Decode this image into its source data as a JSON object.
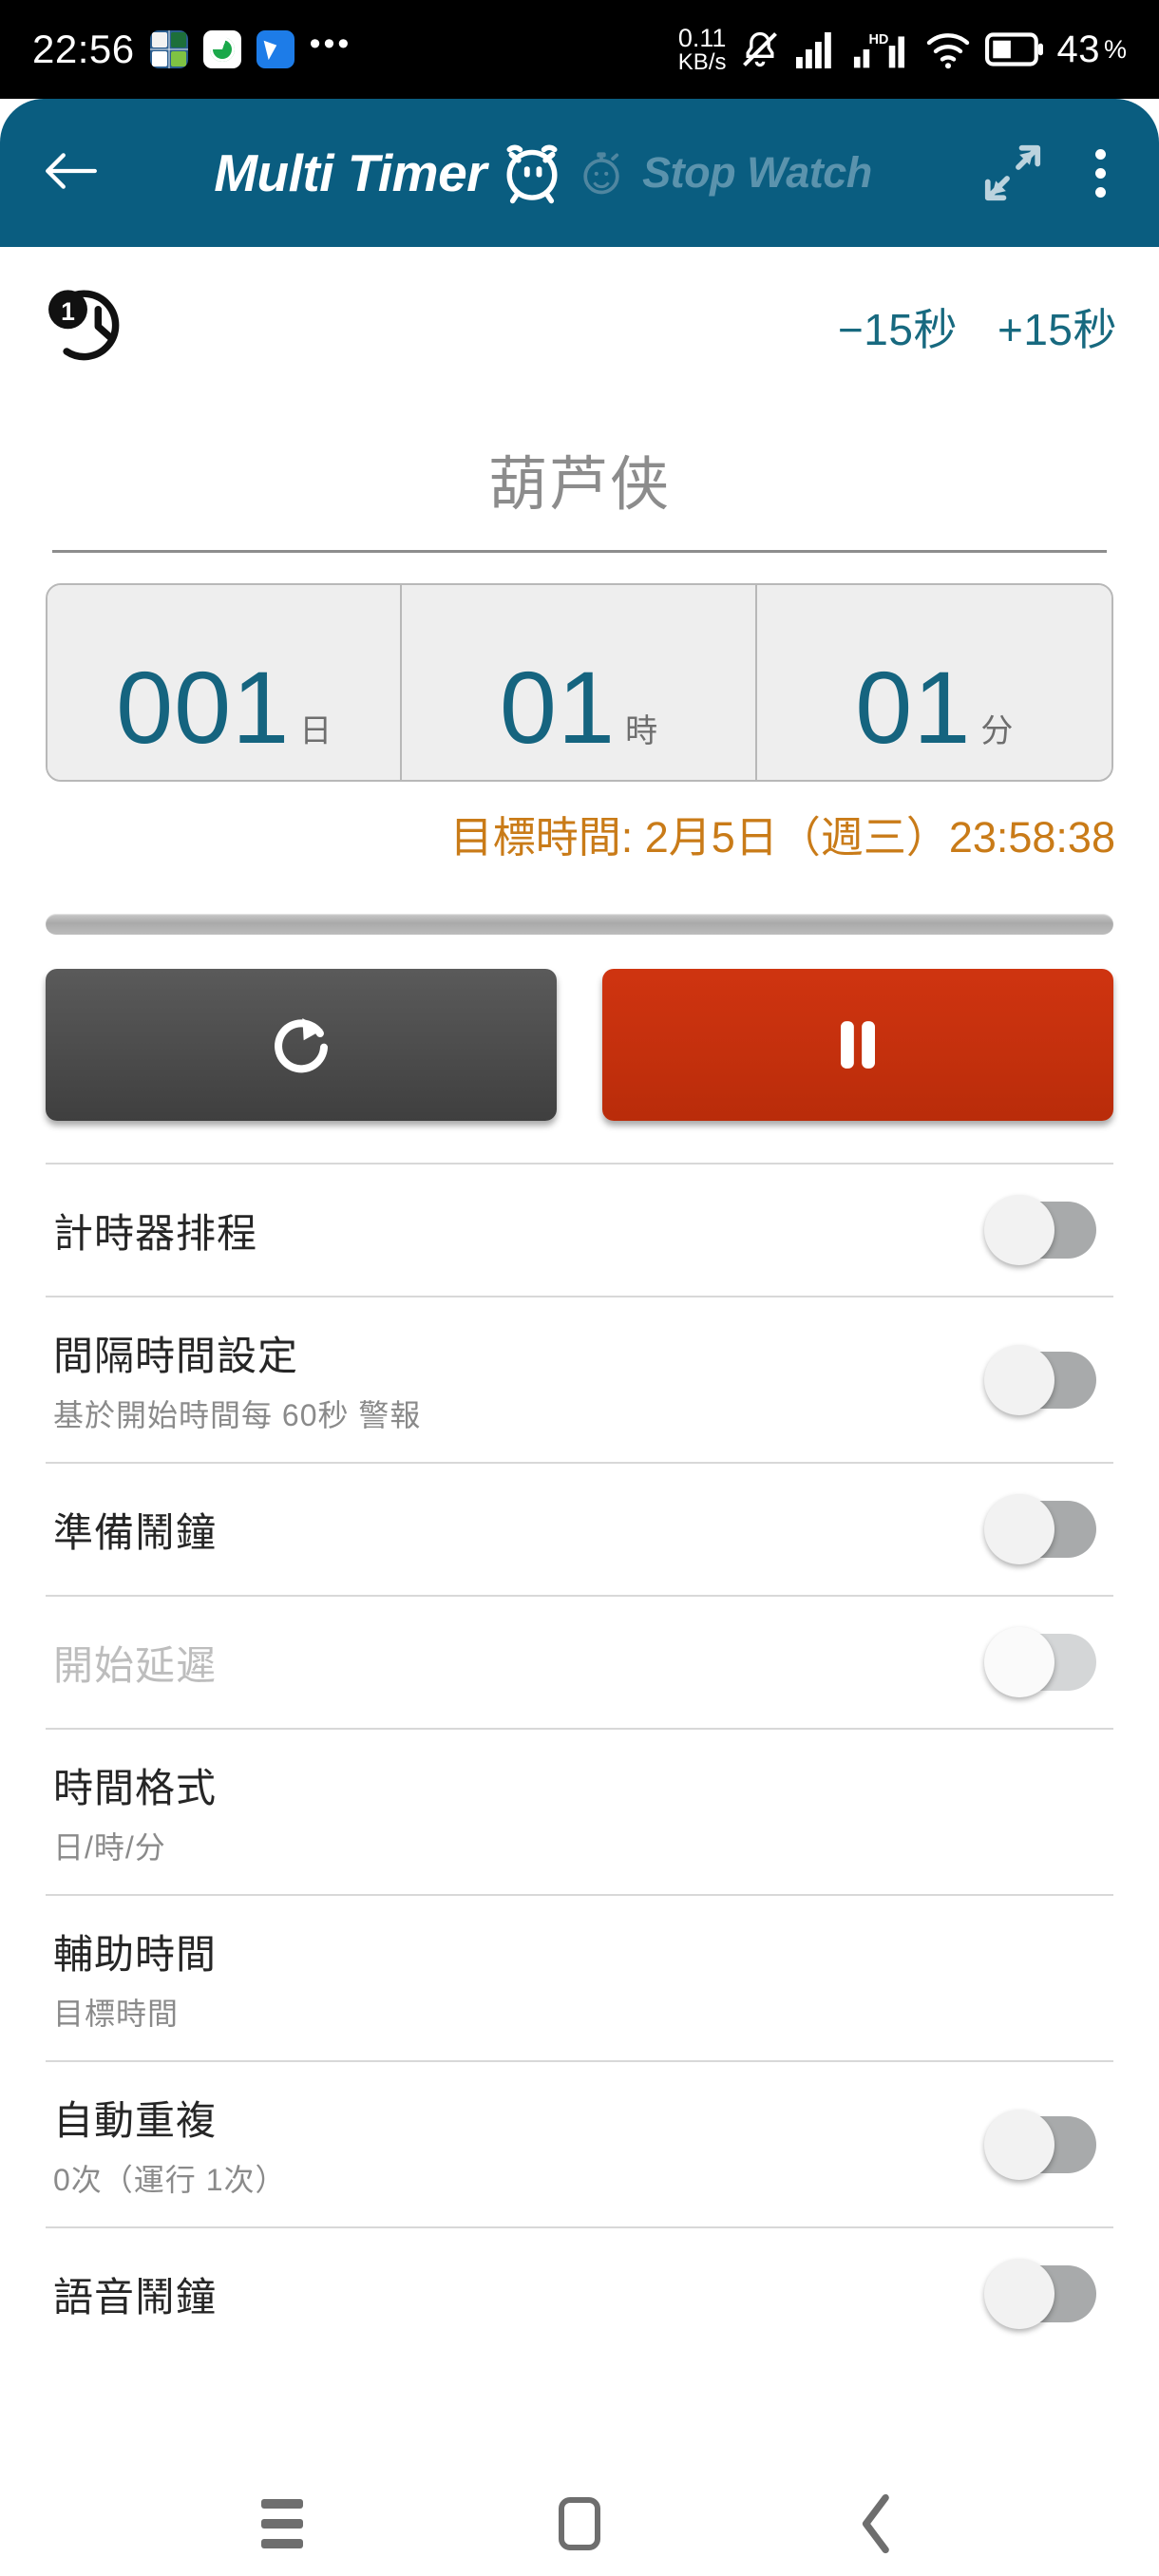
{
  "status_bar": {
    "time": "22:56",
    "overflow_dots": "•••",
    "network_speed_value": "0.11",
    "network_speed_unit": "KB/s",
    "volume_state": "mute-icon",
    "signal_1": "signal-bars-icon",
    "hd_label": "HD",
    "signal_2": "signal-bars-icon",
    "wifi": "wifi-icon",
    "battery_percent": "43",
    "battery_suffix": "%",
    "app_icons": [
      "app-grid-icon",
      "green-circle-icon",
      "blue-bird-icon"
    ],
    "background_color": "#000000"
  },
  "app_bar": {
    "back_label": "back-arrow-icon",
    "title": "Multi Timer",
    "alarm_icon": "alarm-clock-icon",
    "stopwatch_icon": "stopwatch-icon",
    "stopwatch_label": "Stop Watch",
    "expand_icon": "expand-diagonal-icon",
    "menu_icon": "kebab-menu-icon",
    "background_color": "#0a5d80",
    "title_color": "#ffffff",
    "inactive_color": "#5b93ad"
  },
  "timer": {
    "index_icon": "clock-badge-1-icon",
    "decrement_label": "−15秒",
    "increment_label": "+15秒",
    "accent_color": "#17697f",
    "name": "葫芦侠",
    "fields": [
      {
        "value": "001",
        "unit": "日"
      },
      {
        "value": "01",
        "unit": "時"
      },
      {
        "value": "01",
        "unit": "分"
      }
    ],
    "target_time": "目標時間: 2月5日（週三）23:58:38",
    "target_time_color": "#c97b18",
    "digit_color": "#15647f",
    "progress_percent": 0,
    "reset_icon": "reset-circular-arrow-icon",
    "pause_icon": "pause-icon",
    "reset_button_color": "#4c4c4c",
    "pause_button_color": "#c4300d"
  },
  "settings": [
    {
      "title": "計時器排程",
      "sub": "",
      "control": "toggle",
      "state": "off",
      "disabled": false
    },
    {
      "title": "間隔時間設定",
      "sub": "基於開始時間每 60秒 警報",
      "control": "toggle",
      "state": "off",
      "disabled": false
    },
    {
      "title": "準備鬧鐘",
      "sub": "",
      "control": "toggle",
      "state": "off",
      "disabled": false
    },
    {
      "title": "開始延遲",
      "sub": "",
      "control": "toggle",
      "state": "off",
      "disabled": true
    },
    {
      "title": "時間格式",
      "sub": "日/時/分",
      "control": "none",
      "disabled": false
    },
    {
      "title": "輔助時間",
      "sub": "目標時間",
      "control": "none",
      "disabled": false
    },
    {
      "title": "自動重複",
      "sub": "0次（運行 1次）",
      "control": "toggle",
      "state": "off",
      "disabled": false
    },
    {
      "title": "語音鬧鐘",
      "sub": "",
      "control": "toggle",
      "state": "off",
      "disabled": false
    }
  ],
  "nav_bar": {
    "recents_icon": "hamburger-recents-icon",
    "home_icon": "home-square-icon",
    "back_icon": "back-chevron-icon"
  }
}
